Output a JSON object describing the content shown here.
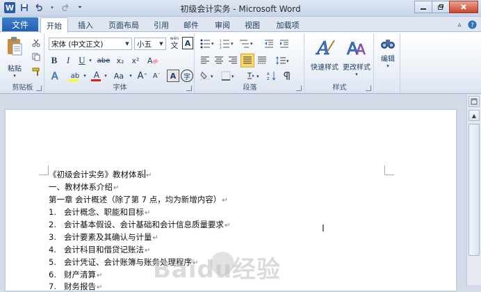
{
  "window": {
    "title": "初级会计实务 - Microsoft Word",
    "app_icon": "W"
  },
  "quick_access": {
    "save_icon": "save-icon",
    "undo_icon": "undo-icon",
    "redo_icon": "redo-icon"
  },
  "tabs": {
    "file": "文件",
    "items": [
      "开始",
      "插入",
      "页面布局",
      "引用",
      "邮件",
      "审阅",
      "视图",
      "加载项"
    ],
    "active": "开始"
  },
  "ribbon": {
    "clipboard": {
      "label": "剪贴板",
      "paste": "粘贴"
    },
    "font": {
      "label": "字体",
      "font_name": "宋体 (中文正文)",
      "font_size": "小五",
      "bold": "B",
      "italic": "I",
      "underline": "U",
      "strike": "abe",
      "sub": "x₂",
      "sup": "x²",
      "grow": "A",
      "shrink": "A",
      "aa": "Aa",
      "wen": "wén",
      "char_border": "A",
      "font_color": "A",
      "highlight": "ab",
      "enclose": "字"
    },
    "paragraph": {
      "label": "段落"
    },
    "styles": {
      "label": "样式",
      "quick": "快速样式",
      "change": "更改样式"
    },
    "editing": {
      "label": "编辑"
    }
  },
  "document": {
    "lines": [
      {
        "num": "",
        "text": "《初级会计实务》教材体系"
      },
      {
        "num": "",
        "text": "一、教材体系介绍"
      },
      {
        "num": "",
        "text": "第一章  会计概述（除了第 7 点，均为新增内容）"
      },
      {
        "num": "1.",
        "text": "会计概念、职能和目标"
      },
      {
        "num": "2.",
        "text": "会计基本假设、会计基础和会计信息质量要求"
      },
      {
        "num": "3.",
        "text": "会计要素及其确认与计量"
      },
      {
        "num": "4.",
        "text": "会计科目和借贷记账法"
      },
      {
        "num": "5.",
        "text": "会计凭证、会计账簿与账务处理程序"
      },
      {
        "num": "6.",
        "text": "财产清算"
      },
      {
        "num": "7.",
        "text": "财务报告"
      }
    ]
  },
  "watermark": "Baidu经验",
  "colors": {
    "file_tab": "#1f5fb3",
    "ribbon_bg": "#e9eef6",
    "font_color_bar": "#e02020",
    "highlight_bar": "#ffff00"
  }
}
